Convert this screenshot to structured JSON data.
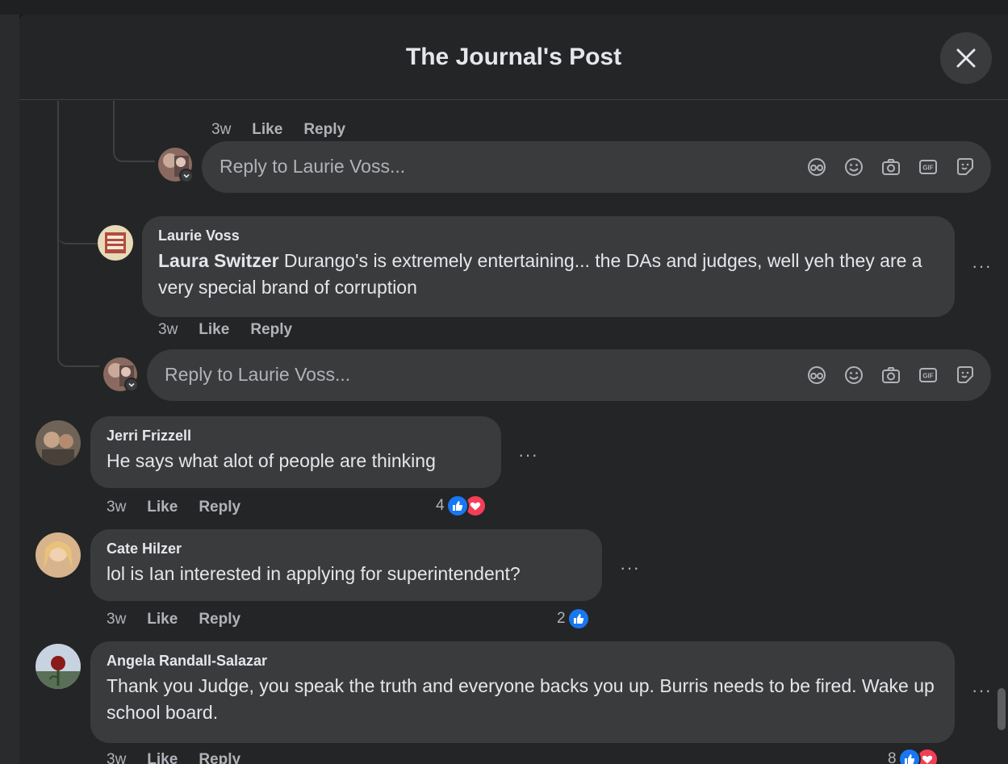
{
  "modal": {
    "title": "The Journal's Post"
  },
  "top_reply_meta": {
    "time": "3w",
    "like": "Like",
    "reply": "Reply"
  },
  "reply_box_1": {
    "placeholder": "Reply to Laurie Voss..."
  },
  "laurie_comment": {
    "author": "Laurie Voss",
    "tag": "Laura Switzer",
    "text": " Durango's is extremely entertaining... the DAs and judges, well yeh they are a very special brand of corruption",
    "time": "3w",
    "like": "Like",
    "reply": "Reply"
  },
  "reply_box_2": {
    "placeholder": "Reply to Laurie Voss..."
  },
  "comments": [
    {
      "author": "Jerri Frizzell",
      "text": "He says what alot of people are thinking",
      "time": "3w",
      "like": "Like",
      "reply": "Reply",
      "reaction_count": "4",
      "reactions": [
        "like",
        "love"
      ]
    },
    {
      "author": "Cate Hilzer",
      "text": "lol is Ian interested in applying for superintendent?",
      "time": "3w",
      "like": "Like",
      "reply": "Reply",
      "reaction_count": "2",
      "reactions": [
        "like"
      ]
    },
    {
      "author": "Angela Randall-Salazar",
      "text": "Thank you Judge, you speak the truth and everyone backs you up. Burris needs to be fired. Wake up school board.",
      "time": "3w",
      "like": "Like",
      "reply": "Reply",
      "reaction_count": "8",
      "reactions": [
        "like",
        "love"
      ]
    }
  ],
  "reply_icons": [
    "avatar-sticker-icon",
    "emoji-icon",
    "camera-icon",
    "gif-icon",
    "sticker-icon"
  ],
  "colors": {
    "background": "#242526",
    "bubble": "#3a3b3c",
    "text": "#e4e6eb",
    "secondary": "#b0b3b8",
    "like": "#1877f2",
    "love": "#f33e58"
  }
}
